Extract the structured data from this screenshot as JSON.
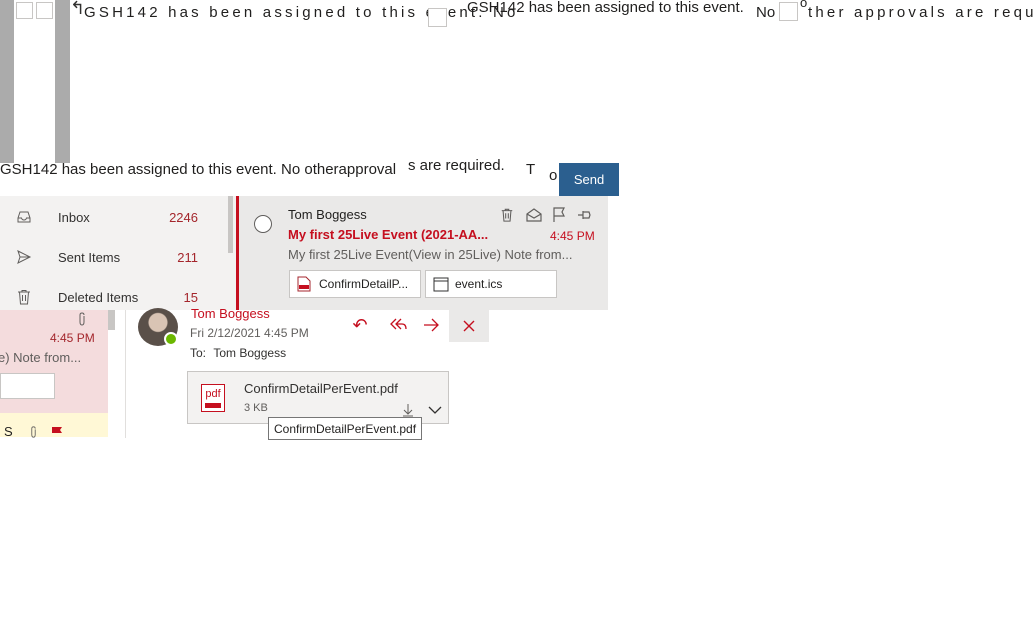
{
  "overlay_text": {
    "line1_spaced_a": "GSH142 has been assigned to this event. No",
    "line1_plain": "GSH142 has been assigned to this event.",
    "line1_no": "No",
    "line1_o": "o",
    "line1_spaced_b": "ther approvals are required.",
    "compose_line": "GSH142 has been assigned to this event. No otherapproval",
    "compose_tail": "s are required.",
    "compose_t": "T",
    "compose_o": "o"
  },
  "compose": {
    "send_label": "Send"
  },
  "nav": {
    "items": [
      {
        "label": "Inbox",
        "count": "2246",
        "icon": "inbox-icon"
      },
      {
        "label": "Sent Items",
        "count": "211",
        "icon": "send-icon"
      },
      {
        "label": "Deleted Items",
        "count": "15",
        "icon": "trash-icon"
      }
    ]
  },
  "message": {
    "sender": "Tom Boggess",
    "subject": "My first 25Live Event (2021-AA...",
    "time": "4:45 PM",
    "preview": "My first 25Live Event(View in 25Live) Note from...",
    "attachments": [
      {
        "name": "ConfirmDetailP...",
        "icon": "pdf-icon"
      },
      {
        "name": "event.ics",
        "icon": "calendar-icon"
      }
    ]
  },
  "left_list": {
    "time": "4:45 PM",
    "preview": "e) Note from...",
    "row_letter": "S"
  },
  "reading": {
    "sender": "Tom Boggess",
    "date": "Fri 2/12/2021 4:45 PM",
    "to_label": "To:",
    "to_name": "Tom Boggess",
    "attachment_name": "ConfirmDetailPerEvent.pdf",
    "attachment_size": "3 KB",
    "attachment_type": "pdf",
    "tooltip": "ConfirmDetailPerEvent.pdf"
  },
  "colors": {
    "accent": "#c50f1f",
    "send": "#2b5f8f",
    "count": "#a4262c"
  }
}
